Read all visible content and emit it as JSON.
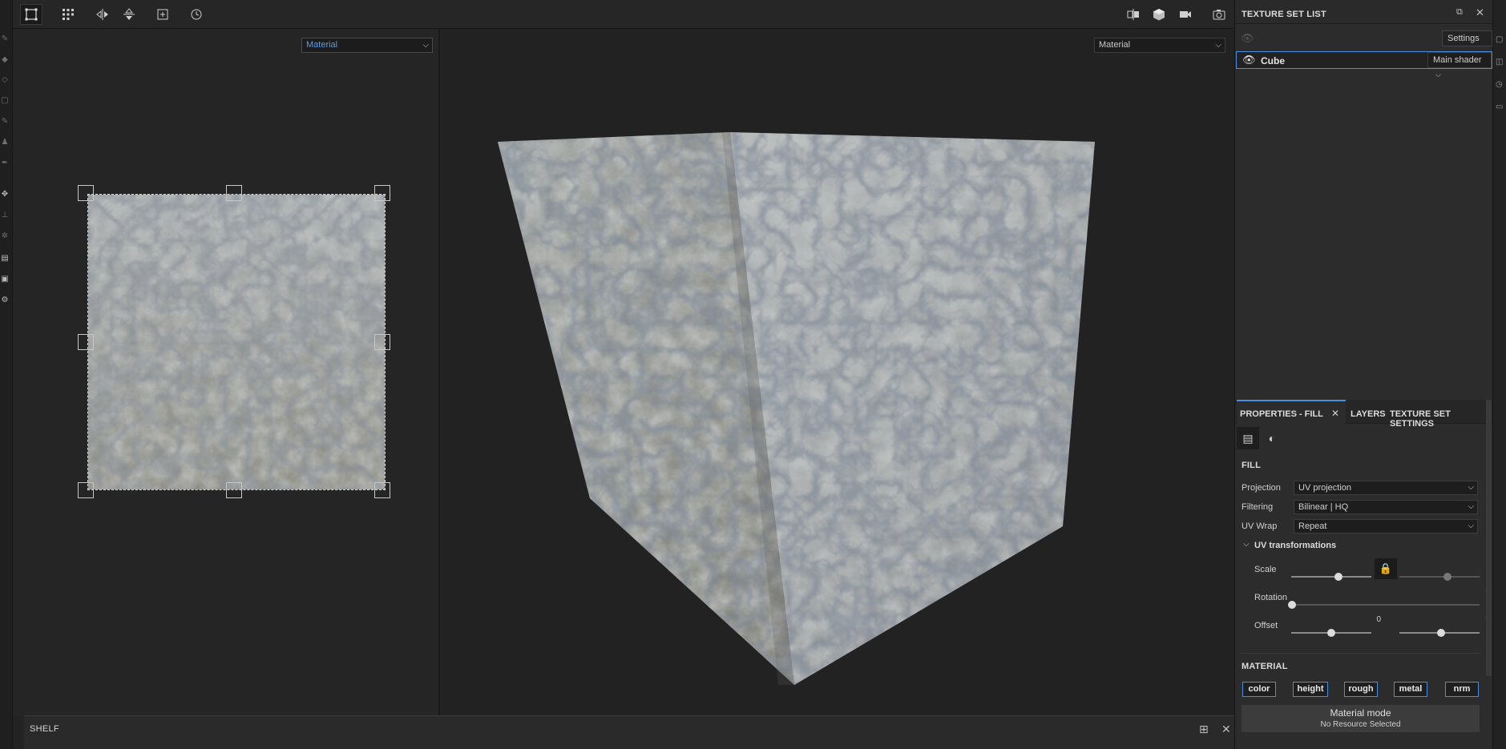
{
  "toolbar": {
    "left_icons": [
      "select-all-icon",
      "grid-icon",
      "flip-horizontal-icon",
      "flip-vertical-icon",
      "add-icon",
      "history-icon"
    ],
    "right_icons": [
      "split-view-icon",
      "cube-icon",
      "camera-icon",
      "screenshot-icon"
    ]
  },
  "viewport2d": {
    "channel": "Material"
  },
  "viewport3d": {
    "channel": "Material"
  },
  "shelf": {
    "title": "SHELF"
  },
  "texture_set_list": {
    "title": "TEXTURE SET LIST",
    "settings_label": "Settings",
    "item_name": "Cube",
    "shader_label": "Main shader"
  },
  "properties": {
    "tabs": [
      "PROPERTIES - FILL",
      "LAYERS",
      "TEXTURE SET SETTINGS"
    ],
    "fill_heading": "FILL",
    "projection_label": "Projection",
    "projection_value": "UV projection",
    "filtering_label": "Filtering",
    "filtering_value": "Bilinear | HQ",
    "uvwrap_label": "UV Wrap",
    "uvwrap_value": "Repeat",
    "uv_transform_heading": "UV transformations",
    "scale_label": "Scale",
    "scale_value_1": "1",
    "scale_value_2": "1",
    "rotation_label": "Rotation",
    "rotation_value": "0",
    "offset_label": "Offset",
    "offset_value_1": "0",
    "offset_value_2": "0",
    "material_heading": "MATERIAL",
    "channels": [
      "color",
      "height",
      "rough",
      "metal",
      "nrm"
    ],
    "material_mode_title": "Material mode",
    "material_mode_sub": "No Resource Selected"
  },
  "colors": {
    "accent": "#4a8ee0",
    "panel_bg": "#2c2c2c",
    "viewport_bg": "#222222"
  }
}
